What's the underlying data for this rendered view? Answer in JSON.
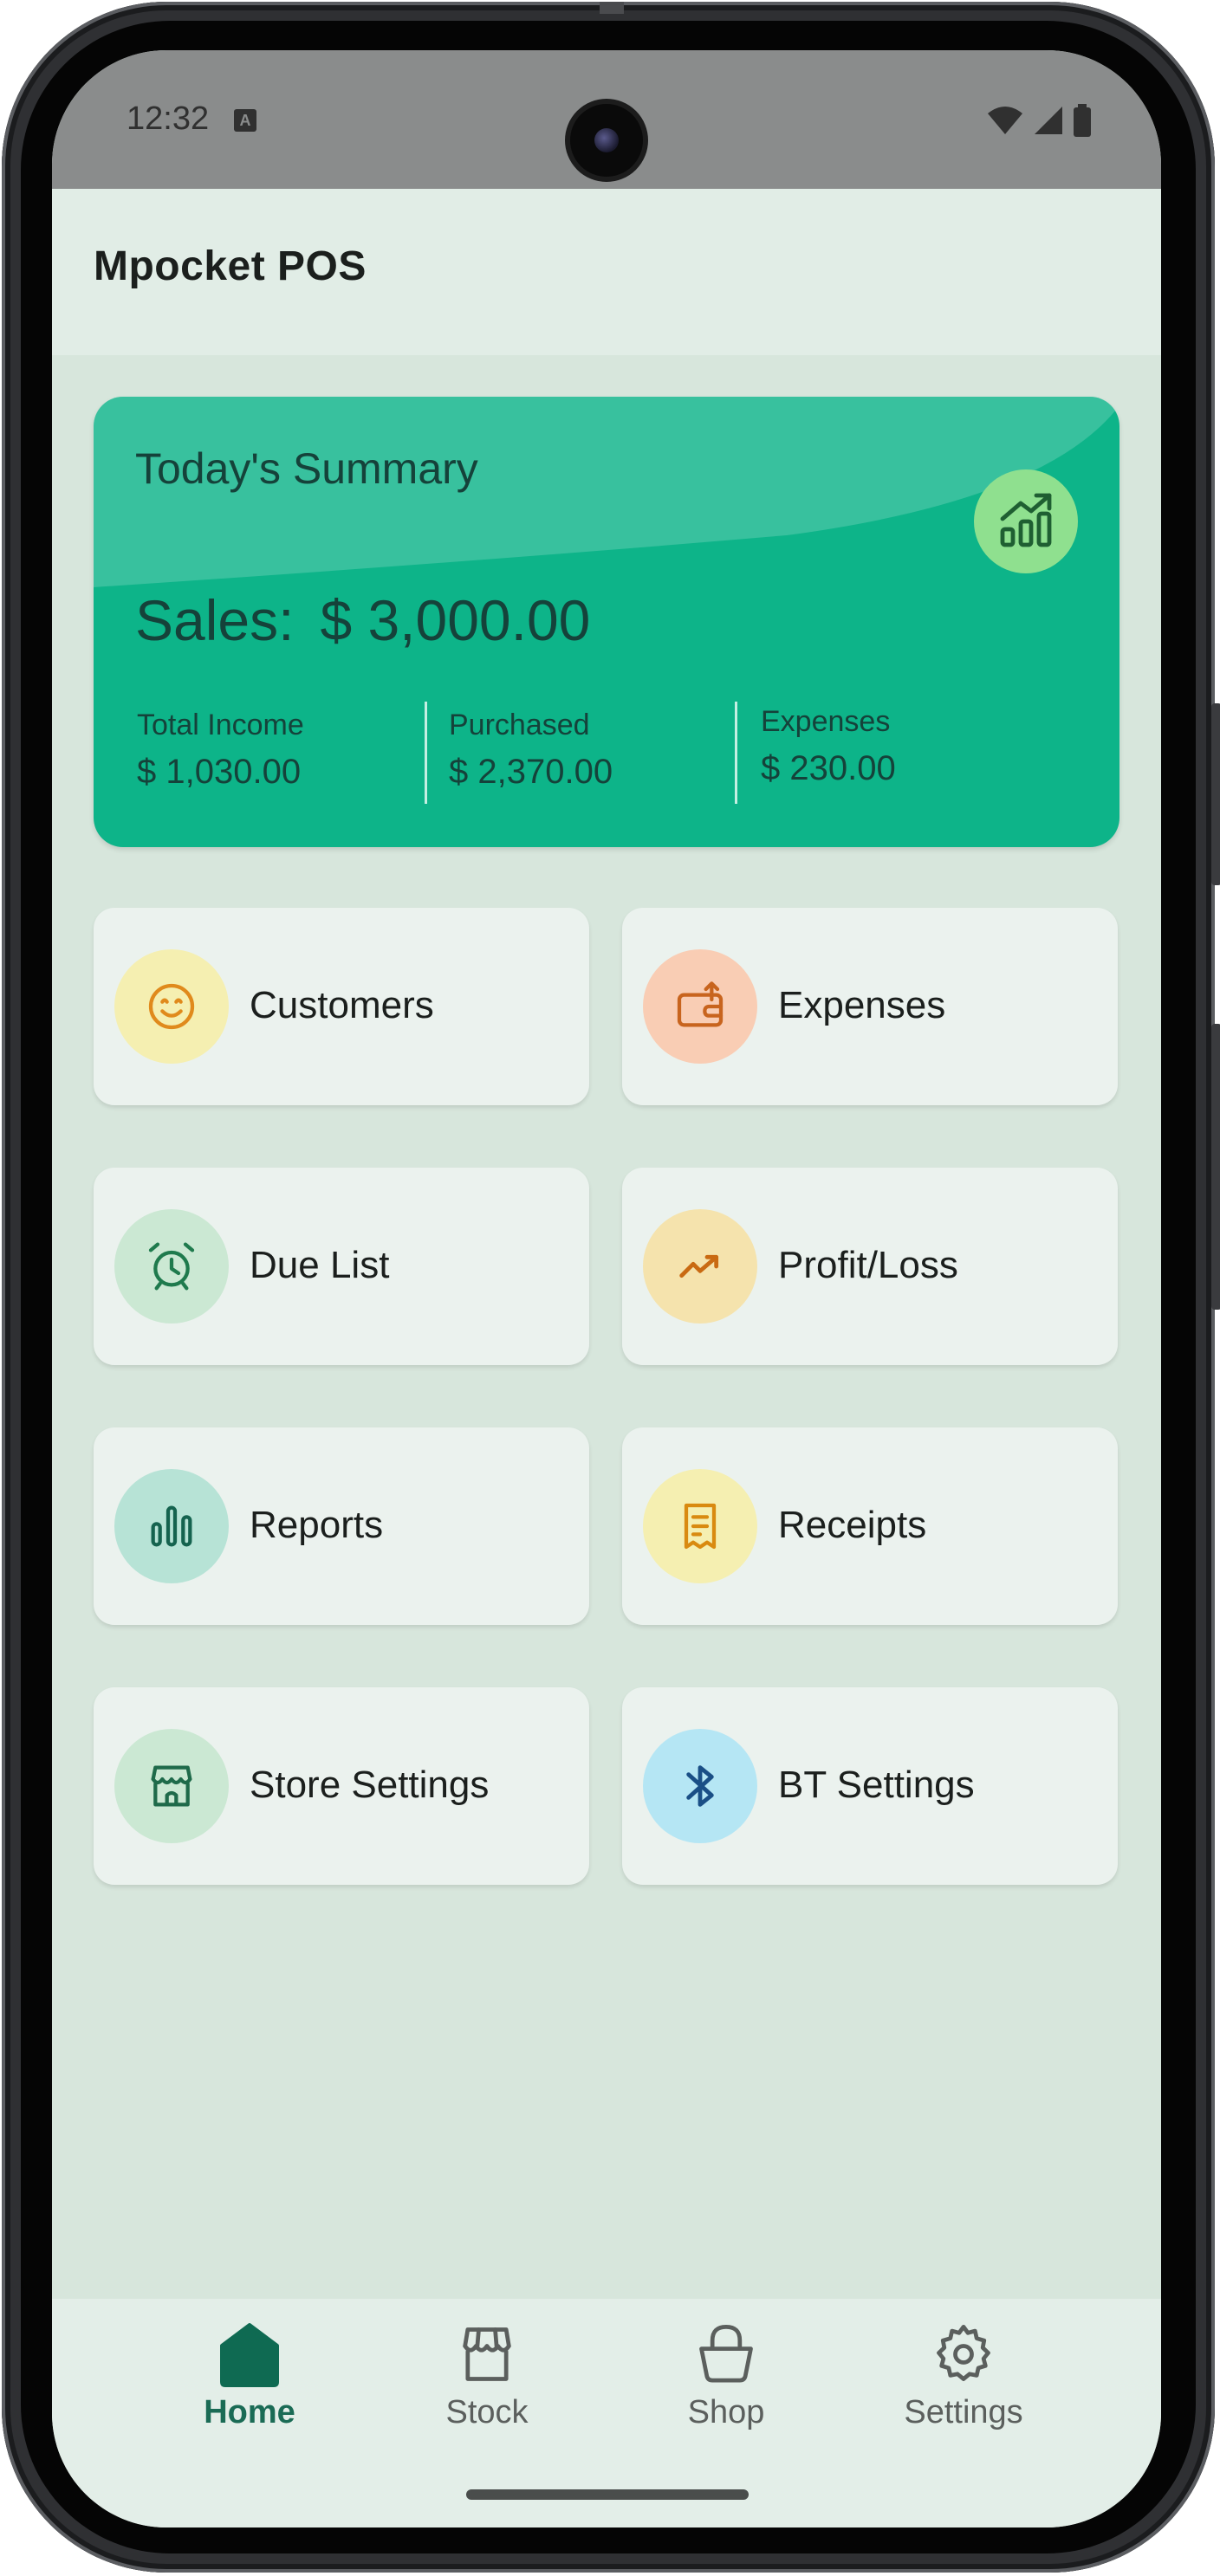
{
  "status_bar": {
    "time": "12:32",
    "notification_icon": "a-icon",
    "right_icons": [
      "wifi-icon",
      "cell-signal-icon",
      "battery-icon"
    ]
  },
  "app_bar": {
    "title": "Mpocket POS"
  },
  "summary": {
    "title": "Today's Summary",
    "sales_label": "Sales:",
    "sales_value": "$ 3,000.00",
    "stats": [
      {
        "label": "Total Income",
        "value": "$ 1,030.00"
      },
      {
        "label": "Purchased",
        "value": "$ 2,370.00"
      },
      {
        "label": "Expenses",
        "value": "$ 230.00"
      }
    ],
    "icon": "chart-trend-icon"
  },
  "tiles": [
    {
      "label": "Customers",
      "icon": "smile-icon",
      "bg": "#f5efb1",
      "fg": "#e08a1c"
    },
    {
      "label": "Expenses",
      "icon": "wallet-out-icon",
      "bg": "#f9cdb4",
      "fg": "#c8641e"
    },
    {
      "label": "Due List",
      "icon": "alarm-clock-icon",
      "bg": "#cbe8d3",
      "fg": "#1f7a4d"
    },
    {
      "label": "Profit/Loss",
      "icon": "trend-up-icon",
      "bg": "#f5e3ad",
      "fg": "#c96a12"
    },
    {
      "label": "Reports",
      "icon": "bar-chart-icon",
      "bg": "#b7e3d6",
      "fg": "#15634f"
    },
    {
      "label": "Receipts",
      "icon": "receipt-icon",
      "bg": "#f5efb1",
      "fg": "#d98a10"
    },
    {
      "label": "Store Settings",
      "icon": "store-icon",
      "bg": "#cbe8d3",
      "fg": "#1f6a4a"
    },
    {
      "label": "BT Settings",
      "icon": "bluetooth-icon",
      "bg": "#b5e6f4",
      "fg": "#1a4f86"
    }
  ],
  "bottom_nav": [
    {
      "label": "Home",
      "icon": "home-icon",
      "active": true
    },
    {
      "label": "Stock",
      "icon": "stock-store-icon",
      "active": false
    },
    {
      "label": "Shop",
      "icon": "shopping-basket-icon",
      "active": false
    },
    {
      "label": "Settings",
      "icon": "gear-icon",
      "active": false
    }
  ],
  "colors": {
    "accent": "#1a6b55",
    "summary_card": "#0db489",
    "background": "#d7e6dc"
  }
}
